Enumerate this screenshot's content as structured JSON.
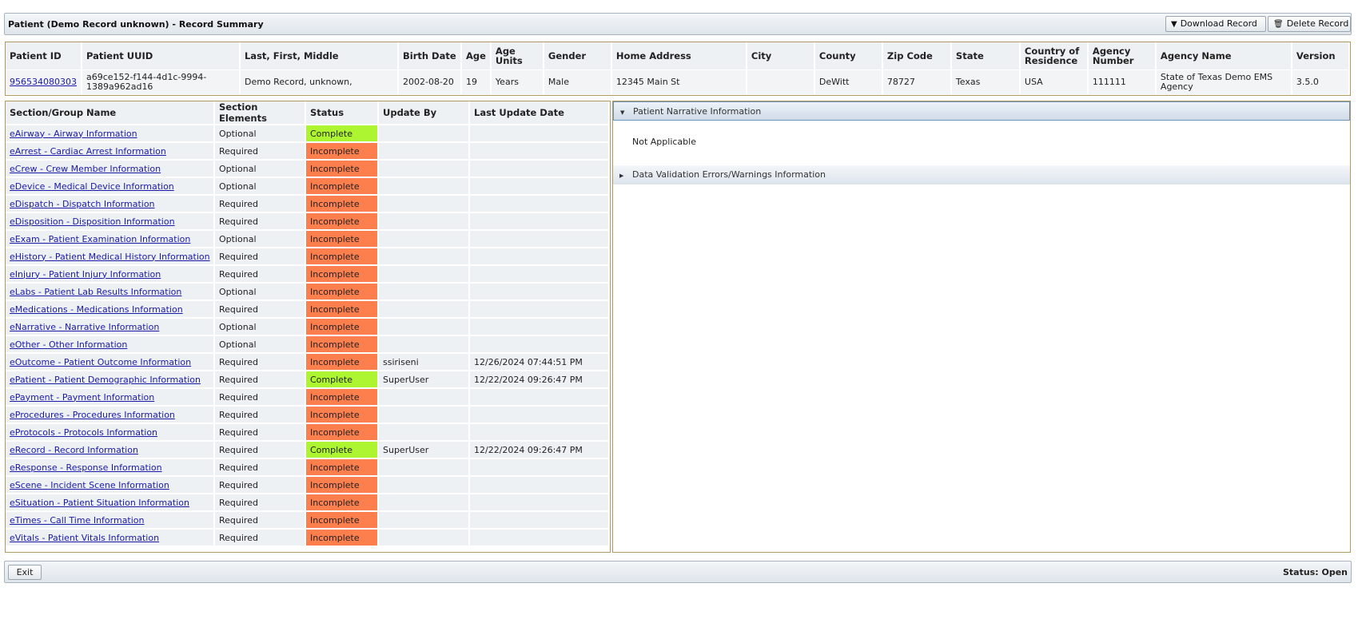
{
  "header": {
    "title": "Patient (Demo Record unknown) - Record Summary",
    "download_label": "Download Record",
    "delete_label": "Delete Record",
    "download_icon": "download-circle-icon",
    "delete_icon": "trash-icon"
  },
  "patient": {
    "columns": [
      "Patient ID",
      "Patient UUID",
      "Last, First, Middle",
      "Birth Date",
      "Age",
      "Age Units",
      "Gender",
      "Home Address",
      "City",
      "County",
      "Zip Code",
      "State",
      "Country of Residence",
      "Agency Number",
      "Agency Name",
      "Version"
    ],
    "row": {
      "patient_id": "956534080303",
      "uuid": "a69ce152-f144-4d1c-9994-1389a962ad16",
      "name": "Demo Record, unknown,",
      "birth_date": "2002-08-20",
      "age": "19",
      "age_units": "Years",
      "gender": "Male",
      "home_address": "12345 Main St",
      "city": "",
      "county": "DeWitt",
      "zip": "78727",
      "state": "Texas",
      "country": "USA",
      "agency_number": "111111",
      "agency_name": "State of Texas Demo EMS Agency",
      "version": "3.5.0"
    }
  },
  "sections": {
    "columns": [
      "Section/Group Name",
      "Section Elements",
      "Status",
      "Update By",
      "Last Update Date"
    ],
    "rows": [
      {
        "name": "eAirway - Airway Information",
        "elements": "Optional",
        "status": "Complete",
        "update_by": "",
        "last_update": ""
      },
      {
        "name": "eArrest - Cardiac Arrest Information",
        "elements": "Required",
        "status": "Incomplete",
        "update_by": "",
        "last_update": ""
      },
      {
        "name": "eCrew - Crew Member Information",
        "elements": "Optional",
        "status": "Incomplete",
        "update_by": "",
        "last_update": ""
      },
      {
        "name": "eDevice - Medical Device Information",
        "elements": "Optional",
        "status": "Incomplete",
        "update_by": "",
        "last_update": ""
      },
      {
        "name": "eDispatch - Dispatch Information",
        "elements": "Required",
        "status": "Incomplete",
        "update_by": "",
        "last_update": ""
      },
      {
        "name": "eDisposition - Disposition Information",
        "elements": "Required",
        "status": "Incomplete",
        "update_by": "",
        "last_update": ""
      },
      {
        "name": "eExam - Patient Examination Information",
        "elements": "Optional",
        "status": "Incomplete",
        "update_by": "",
        "last_update": ""
      },
      {
        "name": "eHistory - Patient Medical History Information",
        "elements": "Required",
        "status": "Incomplete",
        "update_by": "",
        "last_update": ""
      },
      {
        "name": "eInjury - Patient Injury Information",
        "elements": "Required",
        "status": "Incomplete",
        "update_by": "",
        "last_update": ""
      },
      {
        "name": "eLabs - Patient Lab Results Information",
        "elements": "Optional",
        "status": "Incomplete",
        "update_by": "",
        "last_update": ""
      },
      {
        "name": "eMedications - Medications Information",
        "elements": "Required",
        "status": "Incomplete",
        "update_by": "",
        "last_update": ""
      },
      {
        "name": "eNarrative - Narrative Information",
        "elements": "Optional",
        "status": "Incomplete",
        "update_by": "",
        "last_update": ""
      },
      {
        "name": "eOther - Other Information",
        "elements": "Optional",
        "status": "Incomplete",
        "update_by": "",
        "last_update": ""
      },
      {
        "name": "eOutcome - Patient Outcome Information",
        "elements": "Required",
        "status": "Incomplete",
        "update_by": "ssiriseni",
        "last_update": "12/26/2024 07:44:51 PM"
      },
      {
        "name": "ePatient - Patient Demographic Information",
        "elements": "Required",
        "status": "Complete",
        "update_by": "SuperUser",
        "last_update": "12/22/2024 09:26:47 PM"
      },
      {
        "name": "ePayment - Payment Information",
        "elements": "Required",
        "status": "Incomplete",
        "update_by": "",
        "last_update": ""
      },
      {
        "name": "eProcedures - Procedures Information",
        "elements": "Required",
        "status": "Incomplete",
        "update_by": "",
        "last_update": ""
      },
      {
        "name": "eProtocols - Protocols Information",
        "elements": "Required",
        "status": "Incomplete",
        "update_by": "",
        "last_update": ""
      },
      {
        "name": "eRecord - Record Information",
        "elements": "Required",
        "status": "Complete",
        "update_by": "SuperUser",
        "last_update": "12/22/2024 09:26:47 PM"
      },
      {
        "name": "eResponse - Response Information",
        "elements": "Required",
        "status": "Incomplete",
        "update_by": "",
        "last_update": ""
      },
      {
        "name": "eScene - Incident Scene Information",
        "elements": "Required",
        "status": "Incomplete",
        "update_by": "",
        "last_update": ""
      },
      {
        "name": "eSituation - Patient Situation Information",
        "elements": "Required",
        "status": "Incomplete",
        "update_by": "",
        "last_update": ""
      },
      {
        "name": "eTimes - Call Time Information",
        "elements": "Required",
        "status": "Incomplete",
        "update_by": "",
        "last_update": ""
      },
      {
        "name": "eVitals - Patient Vitals Information",
        "elements": "Required",
        "status": "Incomplete",
        "update_by": "",
        "last_update": ""
      }
    ]
  },
  "panels": {
    "narrative_title": "Patient Narrative Information",
    "narrative_text": "Not Applicable",
    "validation_title": "Data Validation Errors/Warnings Information"
  },
  "footer": {
    "exit_label": "Exit",
    "status_text": "Status: Open"
  },
  "colors": {
    "complete": "#aef531",
    "incomplete": "#fd7f4e",
    "link": "#1a1aa8"
  }
}
